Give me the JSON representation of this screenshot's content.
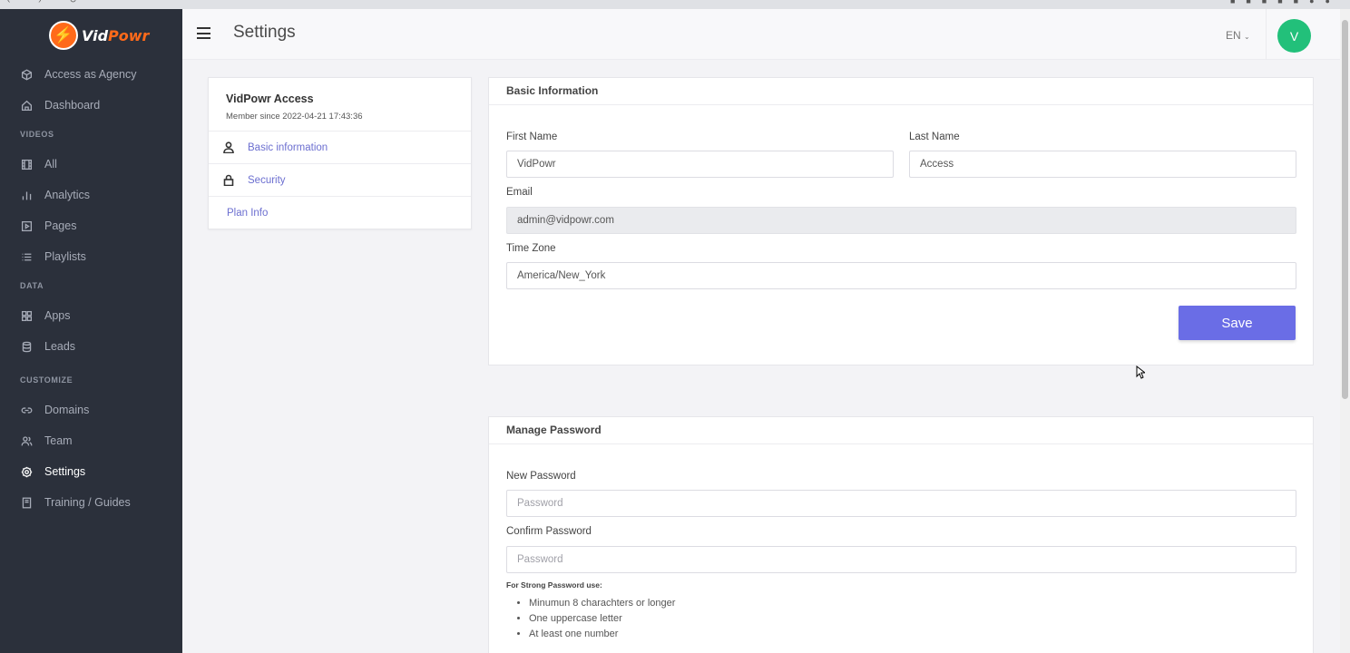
{
  "sidebar": {
    "logo_text_main": "Vid",
    "logo_text_accent": "Powr",
    "items": [
      {
        "label": "Access as Agency",
        "icon": "cube-icon"
      },
      {
        "label": "Dashboard",
        "icon": "home-icon"
      },
      {
        "label": "All",
        "icon": "film-icon"
      },
      {
        "label": "Analytics",
        "icon": "bar-chart-icon"
      },
      {
        "label": "Pages",
        "icon": "play-file-icon"
      },
      {
        "label": "Playlists",
        "icon": "list-icon"
      },
      {
        "label": "Apps",
        "icon": "grid-icon"
      },
      {
        "label": "Leads",
        "icon": "database-icon"
      },
      {
        "label": "Domains",
        "icon": "link-icon"
      },
      {
        "label": "Team",
        "icon": "users-icon"
      },
      {
        "label": "Settings",
        "icon": "gear-icon",
        "active": true
      },
      {
        "label": "Training / Guides",
        "icon": "book-icon"
      }
    ],
    "sections": {
      "videos": "VIDEOS",
      "data": "DATA",
      "customize": "CUSTOMIZE"
    }
  },
  "topbar": {
    "title": "Settings",
    "language": "EN",
    "avatar_initial": "V"
  },
  "profile": {
    "name": "VidPowr Access",
    "member_since": "Member since 2022-04-21 17:43:36",
    "links": [
      {
        "label": "Basic information",
        "icon": "user-icon"
      },
      {
        "label": "Security",
        "icon": "lock-icon"
      },
      {
        "label": "Plan Info"
      }
    ]
  },
  "basic_info": {
    "header": "Basic Information",
    "first_name_label": "First Name",
    "first_name_value": "VidPowr",
    "last_name_label": "Last Name",
    "last_name_value": "Access",
    "email_label": "Email",
    "email_value": "admin@vidpowr.com",
    "timezone_label": "Time Zone",
    "timezone_value": "America/New_York",
    "save_label": "Save"
  },
  "password": {
    "header": "Manage Password",
    "new_label": "New Password",
    "new_placeholder": "Password",
    "confirm_label": "Confirm Password",
    "confirm_placeholder": "Password",
    "hint_title": "For Strong Password use:",
    "hints": [
      "Minumun 8 charachters or longer",
      "One uppercase letter",
      "At least one number"
    ]
  },
  "colors": {
    "sidebar_bg": "#2b303b",
    "accent": "#6a6de6",
    "avatar": "#22c07a",
    "brand_orange": "#ff6a1a"
  }
}
